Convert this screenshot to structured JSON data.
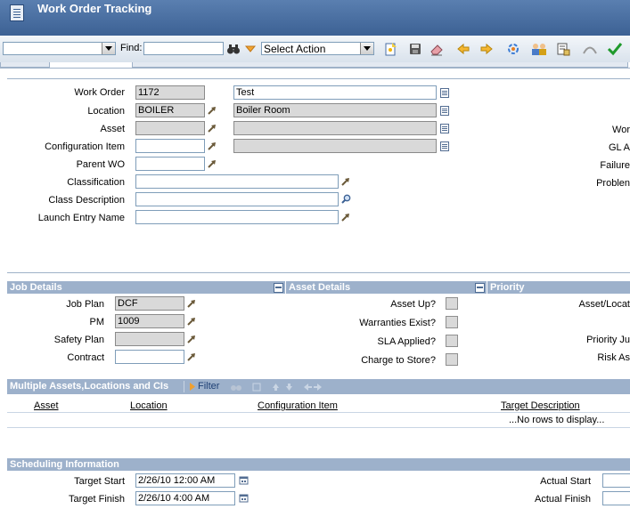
{
  "app": {
    "title": "Work Order Tracking"
  },
  "toolbar": {
    "query_value": "",
    "find_label": "Find:",
    "find_value": "",
    "action_select": "Select Action"
  },
  "main": {
    "work_order": {
      "label": "Work Order",
      "value": "1172",
      "desc": "Test"
    },
    "location": {
      "label": "Location",
      "value": "BOILER",
      "desc": "Boiler Room"
    },
    "asset": {
      "label": "Asset",
      "value": "",
      "desc": ""
    },
    "config_item": {
      "label": "Configuration Item",
      "value": "",
      "desc": ""
    },
    "parent_wo": {
      "label": "Parent WO",
      "value": ""
    },
    "classification": {
      "label": "Classification",
      "value": ""
    },
    "class_description": {
      "label": "Class Description",
      "value": ""
    },
    "launch_entry": {
      "label": "Launch Entry Name",
      "value": ""
    },
    "right_labels": [
      "Wor",
      "GL A",
      "Failure",
      "Problen"
    ]
  },
  "job_details": {
    "title": "Job Details",
    "job_plan": {
      "label": "Job Plan",
      "value": "DCF"
    },
    "pm": {
      "label": "PM",
      "value": "1009"
    },
    "safety_plan": {
      "label": "Safety Plan",
      "value": ""
    },
    "contract": {
      "label": "Contract",
      "value": ""
    }
  },
  "asset_details": {
    "title": "Asset Details",
    "items": [
      "Asset Up?",
      "Warranties Exist?",
      "SLA Applied?",
      "Charge to Store?"
    ]
  },
  "priority": {
    "title": "Priority",
    "labels": [
      "Asset/Locat",
      "Priority Ju",
      "Risk As"
    ]
  },
  "multi_assets": {
    "title": "Multiple Assets,Locations and CIs",
    "filter_label": "Filter",
    "columns": [
      "Asset",
      "Location",
      "Configuration Item",
      "Target Description"
    ],
    "empty_message": "...No rows to display..."
  },
  "scheduling": {
    "title": "Scheduling Information",
    "target_start": {
      "label": "Target Start",
      "value": "2/26/10 12:00 AM"
    },
    "target_finish": {
      "label": "Target Finish",
      "value": "2/26/10 4:00 AM"
    },
    "actual_start": {
      "label": "Actual Start",
      "value": ""
    },
    "actual_finish": {
      "label": "Actual Finish",
      "value": ""
    }
  }
}
